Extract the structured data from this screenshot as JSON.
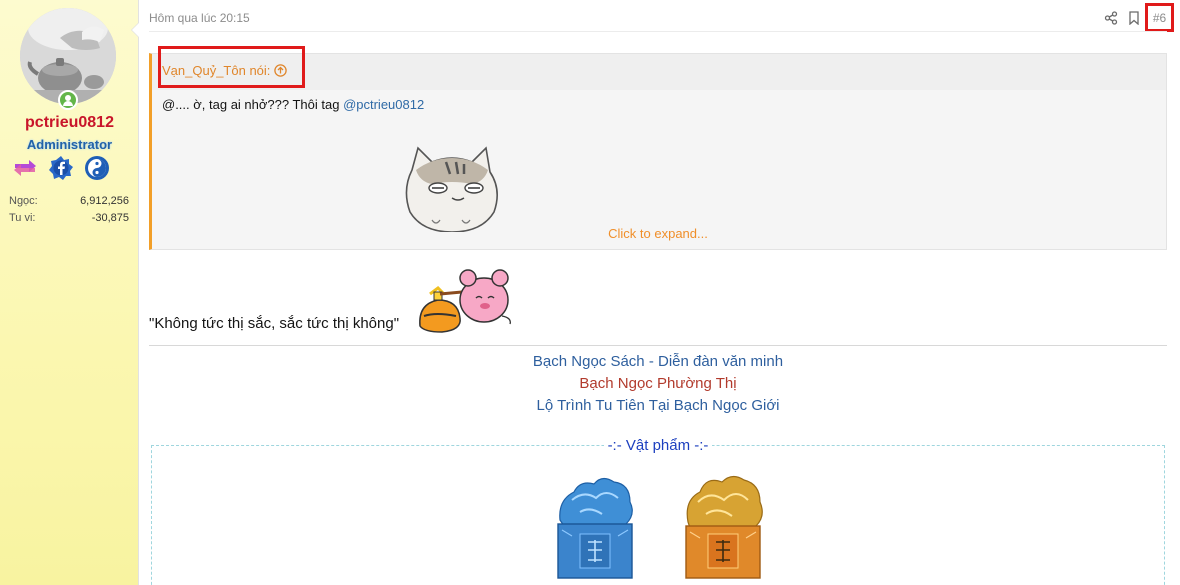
{
  "user": {
    "username": "pctrieu0812",
    "title": "Administrator",
    "badges": [
      "swap-badge-icon",
      "facebook-badge-icon",
      "yinyang-badge-icon"
    ],
    "stats": [
      {
        "label": "Ngọc:",
        "value": "6,912,256"
      },
      {
        "label": "Tu vi:",
        "value": "-30,875"
      }
    ]
  },
  "post": {
    "date": "Hôm qua lúc 20:15",
    "number": "#6",
    "actions": [
      "share-icon",
      "bookmark-icon"
    ]
  },
  "quote": {
    "author": "Vạn_Quỷ_Tôn nói:",
    "text_prefix": "@.... ờ, tag ai nhở??? Thôi tag ",
    "mention": "@pctrieu0812",
    "expand": "Click to expand..."
  },
  "body": {
    "text": "\"Không tức thị sắc, sắc tức thị không\""
  },
  "signature": {
    "line1": "Bạch Ngọc Sách - Diễn đàn văn minh",
    "line2": "Bạch Ngọc Phường Thị",
    "line3": "Lộ Trình Tu Tiên Tại Bạch Ngọc Giới"
  },
  "items": {
    "title": "-:- Vật phẩm -:-"
  },
  "colors": {
    "username": "#c8152a",
    "title": "#2262a8",
    "quote_accent": "#f29f28",
    "highlight_box": "#e01a1a",
    "link": "#2f6aa6"
  }
}
